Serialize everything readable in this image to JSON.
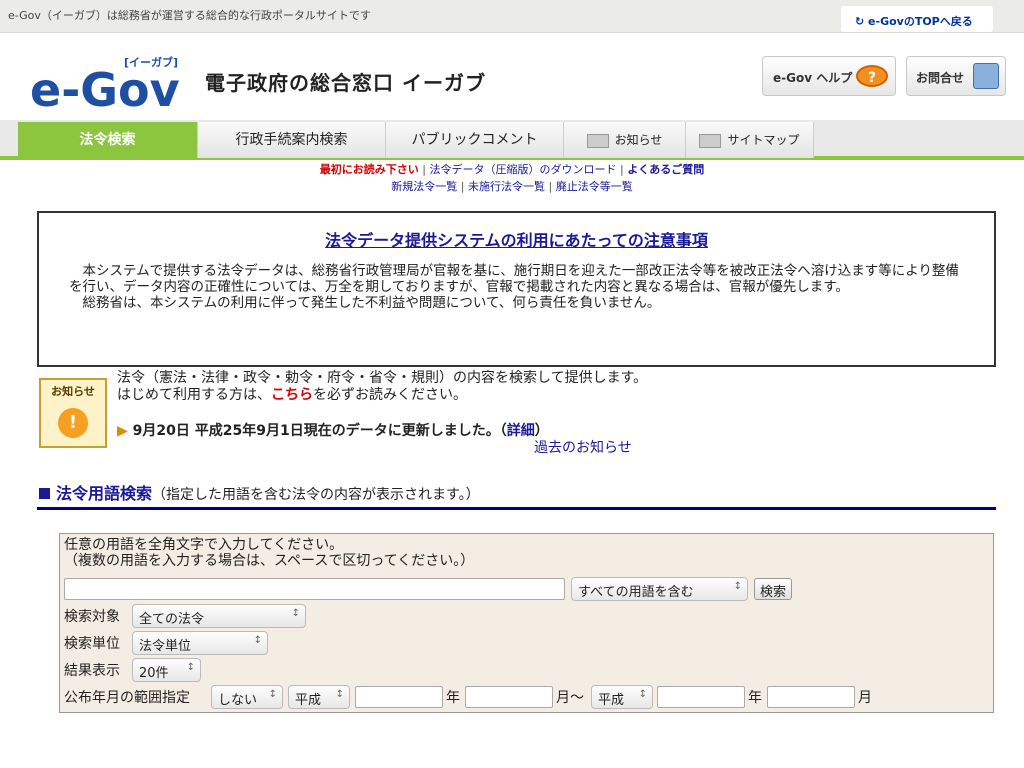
{
  "topbar": {
    "tagline": "e-Gov（イーガブ）は総務省が運営する総合的な行政ポータルサイトです",
    "top_link": "e-GovのTOPへ戻る"
  },
  "header": {
    "logo_text": "e-Gov",
    "logo_kana": "[イーガブ]",
    "site_name": "電子政府の総合窓口 イーガブ",
    "help_label": "e-Gov ヘルプ",
    "contact_label": "お問合せ"
  },
  "nav": {
    "tabs": [
      "法令検索",
      "行政手続案内検索",
      "パブリックコメント",
      "お知らせ",
      "サイトマップ"
    ]
  },
  "sublinks": {
    "first_read": "最初にお読み下さい",
    "download": "法令データ（圧縮版）のダウンロード",
    "faq": "よくあるご質問",
    "new_laws": "新規法令一覧",
    "unenforced": "未施行法令一覧",
    "abolished": "廃止法令等一覧"
  },
  "notice": {
    "title": "法令データ提供システムの利用にあたっての注意事項",
    "p1": "本システムで提供する法令データは、総務省行政管理局が官報を基に、施行期日を迎えた一部改正法令等を被改正法令へ溶け込ます等により整備を行い、データ内容の正確性については、万全を期しておりますが、官報で掲載された内容と異なる場合は、官報が優先します。",
    "p2": "総務省は、本システムの利用に伴って発生した不利益や問題について、何ら責任を負いません。"
  },
  "news": {
    "label": "お知らせ",
    "line1": "法令（憲法・法律・政令・勅令・府令・省令・規則）の内容を検索して提供します。",
    "line2_pre": "はじめて利用する方は、",
    "line2_link": "こちら",
    "line2_post": "を必ずお読みください。",
    "update": "9月20日 平成25年9月1日現在のデータに更新しました。",
    "update_link": "詳細",
    "past": "過去のお知らせ"
  },
  "section": {
    "title": "法令用語検索",
    "subtitle": "（指定した用語を含む法令の内容が表示されます。）"
  },
  "search": {
    "instr1": "任意の用語を全角文字で入力してください。",
    "instr2": "（複数の用語を入力する場合は、スペースで区切ってください。）",
    "term_value": "",
    "match_select": "すべての用語を含む",
    "search_button": "検索",
    "target_label": "検索対象",
    "target_select": "全ての法令",
    "unit_label": "検索単位",
    "unit_select": "法令単位",
    "results_label": "結果表示",
    "results_select": "20件",
    "date_label": "公布年月の範囲指定",
    "date_mode": "しない",
    "era1": "平成",
    "year_unit": "年",
    "month_range": "月〜",
    "era2": "平成",
    "year_unit2": "年",
    "month_unit": "月"
  },
  "colors": {
    "accent_green": "#8cc63f",
    "link_blue": "#1a1a99",
    "alert_red": "#d00000",
    "section_rule": "#00008b"
  }
}
